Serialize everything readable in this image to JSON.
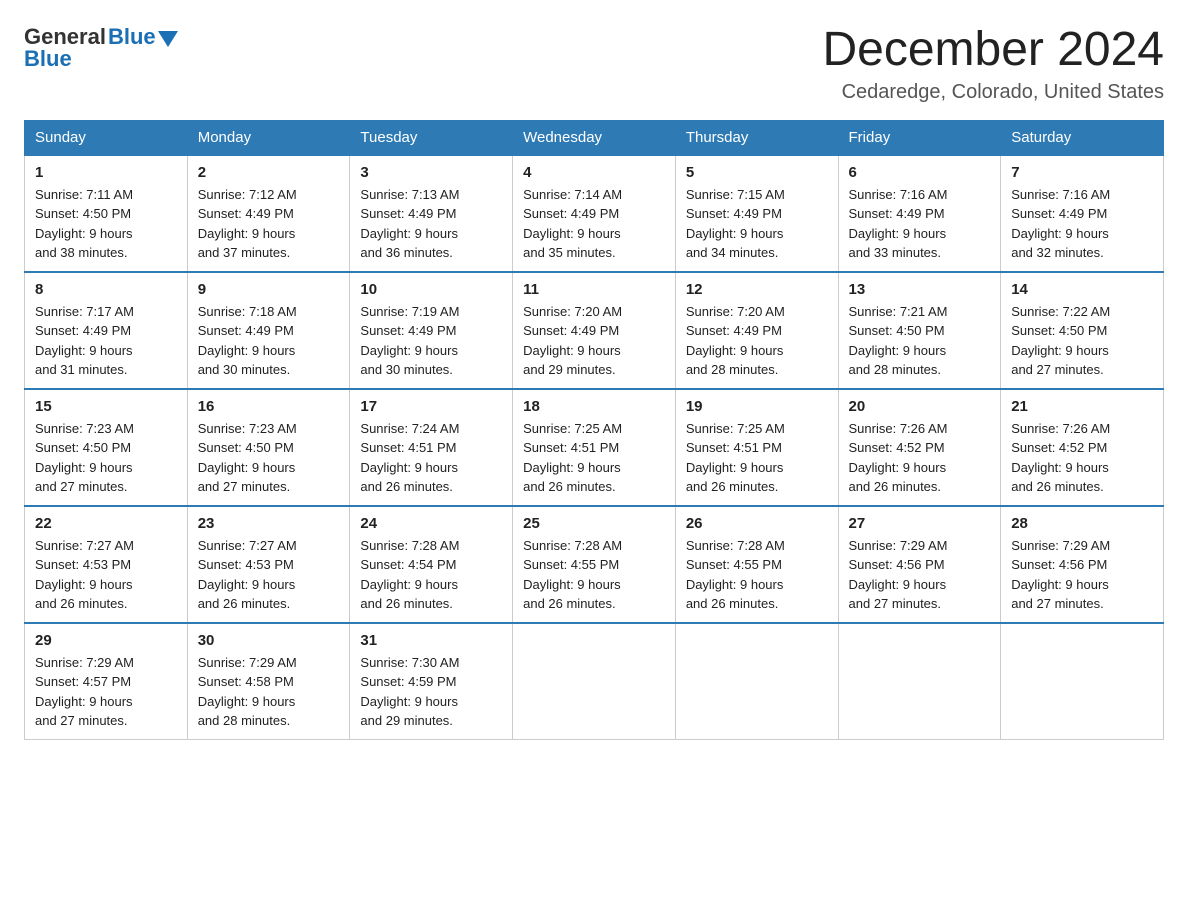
{
  "header": {
    "logo": {
      "general": "General",
      "blue": "Blue"
    },
    "month_title": "December 2024",
    "location": "Cedaredge, Colorado, United States"
  },
  "days_of_week": [
    "Sunday",
    "Monday",
    "Tuesday",
    "Wednesday",
    "Thursday",
    "Friday",
    "Saturday"
  ],
  "weeks": [
    [
      {
        "day": "1",
        "sunrise": "7:11 AM",
        "sunset": "4:50 PM",
        "daylight": "9 hours and 38 minutes."
      },
      {
        "day": "2",
        "sunrise": "7:12 AM",
        "sunset": "4:49 PM",
        "daylight": "9 hours and 37 minutes."
      },
      {
        "day": "3",
        "sunrise": "7:13 AM",
        "sunset": "4:49 PM",
        "daylight": "9 hours and 36 minutes."
      },
      {
        "day": "4",
        "sunrise": "7:14 AM",
        "sunset": "4:49 PM",
        "daylight": "9 hours and 35 minutes."
      },
      {
        "day": "5",
        "sunrise": "7:15 AM",
        "sunset": "4:49 PM",
        "daylight": "9 hours and 34 minutes."
      },
      {
        "day": "6",
        "sunrise": "7:16 AM",
        "sunset": "4:49 PM",
        "daylight": "9 hours and 33 minutes."
      },
      {
        "day": "7",
        "sunrise": "7:16 AM",
        "sunset": "4:49 PM",
        "daylight": "9 hours and 32 minutes."
      }
    ],
    [
      {
        "day": "8",
        "sunrise": "7:17 AM",
        "sunset": "4:49 PM",
        "daylight": "9 hours and 31 minutes."
      },
      {
        "day": "9",
        "sunrise": "7:18 AM",
        "sunset": "4:49 PM",
        "daylight": "9 hours and 30 minutes."
      },
      {
        "day": "10",
        "sunrise": "7:19 AM",
        "sunset": "4:49 PM",
        "daylight": "9 hours and 30 minutes."
      },
      {
        "day": "11",
        "sunrise": "7:20 AM",
        "sunset": "4:49 PM",
        "daylight": "9 hours and 29 minutes."
      },
      {
        "day": "12",
        "sunrise": "7:20 AM",
        "sunset": "4:49 PM",
        "daylight": "9 hours and 28 minutes."
      },
      {
        "day": "13",
        "sunrise": "7:21 AM",
        "sunset": "4:50 PM",
        "daylight": "9 hours and 28 minutes."
      },
      {
        "day": "14",
        "sunrise": "7:22 AM",
        "sunset": "4:50 PM",
        "daylight": "9 hours and 27 minutes."
      }
    ],
    [
      {
        "day": "15",
        "sunrise": "7:23 AM",
        "sunset": "4:50 PM",
        "daylight": "9 hours and 27 minutes."
      },
      {
        "day": "16",
        "sunrise": "7:23 AM",
        "sunset": "4:50 PM",
        "daylight": "9 hours and 27 minutes."
      },
      {
        "day": "17",
        "sunrise": "7:24 AM",
        "sunset": "4:51 PM",
        "daylight": "9 hours and 26 minutes."
      },
      {
        "day": "18",
        "sunrise": "7:25 AM",
        "sunset": "4:51 PM",
        "daylight": "9 hours and 26 minutes."
      },
      {
        "day": "19",
        "sunrise": "7:25 AM",
        "sunset": "4:51 PM",
        "daylight": "9 hours and 26 minutes."
      },
      {
        "day": "20",
        "sunrise": "7:26 AM",
        "sunset": "4:52 PM",
        "daylight": "9 hours and 26 minutes."
      },
      {
        "day": "21",
        "sunrise": "7:26 AM",
        "sunset": "4:52 PM",
        "daylight": "9 hours and 26 minutes."
      }
    ],
    [
      {
        "day": "22",
        "sunrise": "7:27 AM",
        "sunset": "4:53 PM",
        "daylight": "9 hours and 26 minutes."
      },
      {
        "day": "23",
        "sunrise": "7:27 AM",
        "sunset": "4:53 PM",
        "daylight": "9 hours and 26 minutes."
      },
      {
        "day": "24",
        "sunrise": "7:28 AM",
        "sunset": "4:54 PM",
        "daylight": "9 hours and 26 minutes."
      },
      {
        "day": "25",
        "sunrise": "7:28 AM",
        "sunset": "4:55 PM",
        "daylight": "9 hours and 26 minutes."
      },
      {
        "day": "26",
        "sunrise": "7:28 AM",
        "sunset": "4:55 PM",
        "daylight": "9 hours and 26 minutes."
      },
      {
        "day": "27",
        "sunrise": "7:29 AM",
        "sunset": "4:56 PM",
        "daylight": "9 hours and 27 minutes."
      },
      {
        "day": "28",
        "sunrise": "7:29 AM",
        "sunset": "4:56 PM",
        "daylight": "9 hours and 27 minutes."
      }
    ],
    [
      {
        "day": "29",
        "sunrise": "7:29 AM",
        "sunset": "4:57 PM",
        "daylight": "9 hours and 27 minutes."
      },
      {
        "day": "30",
        "sunrise": "7:29 AM",
        "sunset": "4:58 PM",
        "daylight": "9 hours and 28 minutes."
      },
      {
        "day": "31",
        "sunrise": "7:30 AM",
        "sunset": "4:59 PM",
        "daylight": "9 hours and 29 minutes."
      },
      null,
      null,
      null,
      null
    ]
  ],
  "labels": {
    "sunrise": "Sunrise: ",
    "sunset": "Sunset: ",
    "daylight": "Daylight: "
  }
}
